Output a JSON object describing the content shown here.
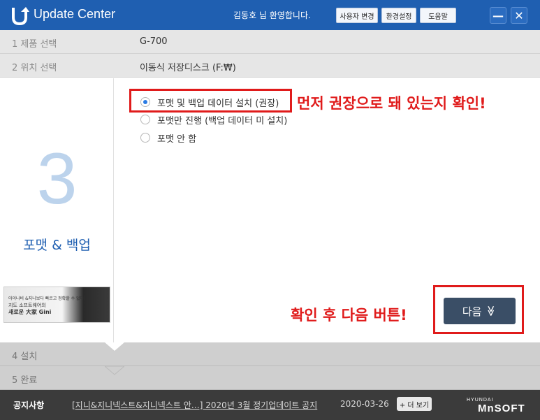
{
  "app": {
    "title": "Update Center",
    "welcome": "김동호 님 환영합니다.",
    "buttons": {
      "user_change": "사용자 변경",
      "settings": "환경설정",
      "help": "도움말"
    },
    "minimize_glyph": "—",
    "close_glyph": "✕"
  },
  "steps": [
    {
      "label": "1  제품 선택",
      "value": "G-700"
    },
    {
      "label": "2  위치 선택",
      "value": "이동식 저장디스크 (F:₩)"
    },
    {
      "label": "4  설치"
    },
    {
      "label": "5  완료"
    }
  ],
  "current_step": {
    "number": "3",
    "name": "포맷 & 백업"
  },
  "banner": {
    "line1": "아이나비 &지니보다 빠르고 정확할 수 없다!",
    "line2": "지도 소프트웨어의",
    "line3": "새로운 大家 Gini"
  },
  "options": [
    {
      "label": "포맷 및 백업 데이터 설치 (권장)",
      "selected": true
    },
    {
      "label": "포맷만 진행 (백업 데이터 미 설치)",
      "selected": false
    },
    {
      "label": "포맷 안 함",
      "selected": false
    }
  ],
  "annotations": {
    "top": "먼저 권장으로 돼 있는지 확인!",
    "bottom": "확인 후 다음 버튼!"
  },
  "next_button": {
    "label": "다음",
    "glyph": "≫"
  },
  "notice": {
    "title": "공지사항",
    "text": "[지니&지니넥스트&지니넥스트 안…] 2020년 3월 정기업데이트 공지",
    "date": "2020-03-26",
    "more": "+ 더 보기"
  },
  "brand": {
    "small": "HYUNDAI",
    "big": "MnSOFT"
  },
  "colors": {
    "titlebar": "#1f5fb1",
    "accent": "#1f5fb1",
    "annotation": "#e01b1b",
    "next_button": "#3a4e66"
  }
}
